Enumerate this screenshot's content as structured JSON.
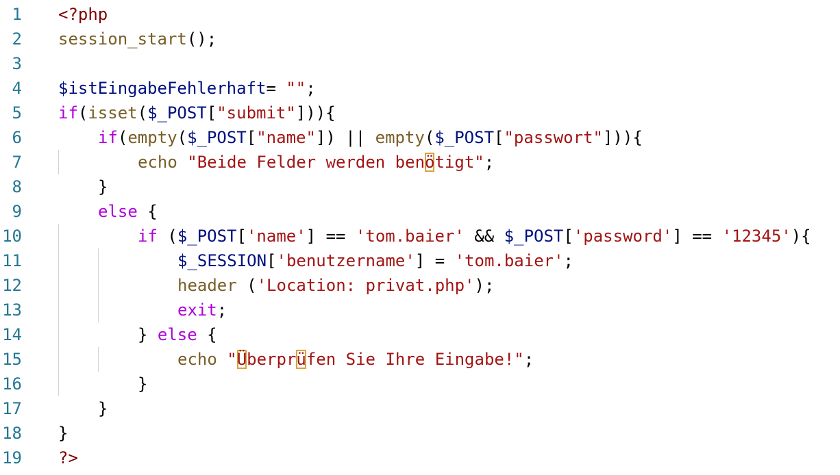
{
  "colors": {
    "background": "#ffffff",
    "line_number": "#237893",
    "php_tag": "#800000",
    "keyword": "#af00db",
    "function": "#795e26",
    "variable": "#001080",
    "string": "#a31515",
    "plain": "#000000",
    "indent_guide": "#d3d3d3",
    "unicode_highlight_border": "#d8a339"
  },
  "lines": [
    {
      "number": "1",
      "indent": 0,
      "tokens": [
        {
          "t": "<?php",
          "k": "php_tag"
        }
      ]
    },
    {
      "number": "2",
      "indent": 0,
      "tokens": [
        {
          "t": "session_start",
          "k": "function"
        },
        {
          "t": "();",
          "k": "plain"
        }
      ]
    },
    {
      "number": "3",
      "indent": 0,
      "tokens": []
    },
    {
      "number": "4",
      "indent": 0,
      "tokens": [
        {
          "t": "$istEingabeFehlerhaft",
          "k": "variable"
        },
        {
          "t": "= ",
          "k": "plain"
        },
        {
          "t": "\"\"",
          "k": "string"
        },
        {
          "t": ";",
          "k": "plain"
        }
      ]
    },
    {
      "number": "5",
      "indent": 0,
      "tokens": [
        {
          "t": "if",
          "k": "keyword"
        },
        {
          "t": "(",
          "k": "plain"
        },
        {
          "t": "isset",
          "k": "function"
        },
        {
          "t": "(",
          "k": "plain"
        },
        {
          "t": "$_POST",
          "k": "variable"
        },
        {
          "t": "[",
          "k": "plain"
        },
        {
          "t": "\"submit\"",
          "k": "string"
        },
        {
          "t": "])){",
          "k": "plain"
        }
      ]
    },
    {
      "number": "6",
      "indent": 1,
      "tokens": [
        {
          "t": "if",
          "k": "keyword"
        },
        {
          "t": "(",
          "k": "plain"
        },
        {
          "t": "empty",
          "k": "function"
        },
        {
          "t": "(",
          "k": "plain"
        },
        {
          "t": "$_POST",
          "k": "variable"
        },
        {
          "t": "[",
          "k": "plain"
        },
        {
          "t": "\"name\"",
          "k": "string"
        },
        {
          "t": "]) || ",
          "k": "plain"
        },
        {
          "t": "empty",
          "k": "function"
        },
        {
          "t": "(",
          "k": "plain"
        },
        {
          "t": "$_POST",
          "k": "variable"
        },
        {
          "t": "[",
          "k": "plain"
        },
        {
          "t": "\"passwort\"",
          "k": "string"
        },
        {
          "t": "])){",
          "k": "plain"
        }
      ]
    },
    {
      "number": "7",
      "indent": 2,
      "tokens": [
        {
          "t": "echo ",
          "k": "function"
        },
        {
          "t": "\"Beide Felder werden ben",
          "k": "string"
        },
        {
          "t": "ö",
          "k": "string",
          "hl": true
        },
        {
          "t": "tigt\"",
          "k": "string"
        },
        {
          "t": ";",
          "k": "plain"
        }
      ]
    },
    {
      "number": "8",
      "indent": 1,
      "tokens": [
        {
          "t": "}",
          "k": "plain"
        }
      ]
    },
    {
      "number": "9",
      "indent": 1,
      "tokens": [
        {
          "t": "else",
          "k": "keyword"
        },
        {
          "t": " {",
          "k": "plain"
        }
      ]
    },
    {
      "number": "10",
      "indent": 2,
      "tokens": [
        {
          "t": "if",
          "k": "keyword"
        },
        {
          "t": " (",
          "k": "plain"
        },
        {
          "t": "$_POST",
          "k": "variable"
        },
        {
          "t": "[",
          "k": "plain"
        },
        {
          "t": "'name'",
          "k": "string"
        },
        {
          "t": "] == ",
          "k": "plain"
        },
        {
          "t": "'tom.baier'",
          "k": "string"
        },
        {
          "t": " && ",
          "k": "plain"
        },
        {
          "t": "$_POST",
          "k": "variable"
        },
        {
          "t": "[",
          "k": "plain"
        },
        {
          "t": "'password'",
          "k": "string"
        },
        {
          "t": "] == ",
          "k": "plain"
        },
        {
          "t": "'12345'",
          "k": "string"
        },
        {
          "t": "){",
          "k": "plain"
        }
      ]
    },
    {
      "number": "11",
      "indent": 3,
      "tokens": [
        {
          "t": "$_SESSION",
          "k": "variable"
        },
        {
          "t": "[",
          "k": "plain"
        },
        {
          "t": "'benutzername'",
          "k": "string"
        },
        {
          "t": "] = ",
          "k": "plain"
        },
        {
          "t": "'tom.baier'",
          "k": "string"
        },
        {
          "t": ";",
          "k": "plain"
        }
      ]
    },
    {
      "number": "12",
      "indent": 3,
      "tokens": [
        {
          "t": "header",
          "k": "function"
        },
        {
          "t": " (",
          "k": "plain"
        },
        {
          "t": "'Location: privat.php'",
          "k": "string"
        },
        {
          "t": ");",
          "k": "plain"
        }
      ]
    },
    {
      "number": "13",
      "indent": 3,
      "tokens": [
        {
          "t": "exit",
          "k": "keyword"
        },
        {
          "t": ";",
          "k": "plain"
        }
      ]
    },
    {
      "number": "14",
      "indent": 2,
      "tokens": [
        {
          "t": "} ",
          "k": "plain"
        },
        {
          "t": "else",
          "k": "keyword"
        },
        {
          "t": " {",
          "k": "plain"
        }
      ]
    },
    {
      "number": "15",
      "indent": 3,
      "tokens": [
        {
          "t": "echo ",
          "k": "function"
        },
        {
          "t": "\"",
          "k": "string"
        },
        {
          "t": "Ü",
          "k": "string",
          "hl": true
        },
        {
          "t": "berpr",
          "k": "string"
        },
        {
          "t": "ü",
          "k": "string",
          "hl": true
        },
        {
          "t": "fen Sie Ihre Eingabe!\"",
          "k": "string"
        },
        {
          "t": ";",
          "k": "plain"
        }
      ]
    },
    {
      "number": "16",
      "indent": 2,
      "tokens": [
        {
          "t": "}",
          "k": "plain"
        }
      ]
    },
    {
      "number": "17",
      "indent": 1,
      "tokens": [
        {
          "t": "}",
          "k": "plain"
        }
      ]
    },
    {
      "number": "18",
      "indent": 0,
      "tokens": [
        {
          "t": "}",
          "k": "plain"
        }
      ]
    },
    {
      "number": "19",
      "indent": 0,
      "tokens": [
        {
          "t": "?>",
          "k": "php_tag"
        }
      ]
    }
  ]
}
